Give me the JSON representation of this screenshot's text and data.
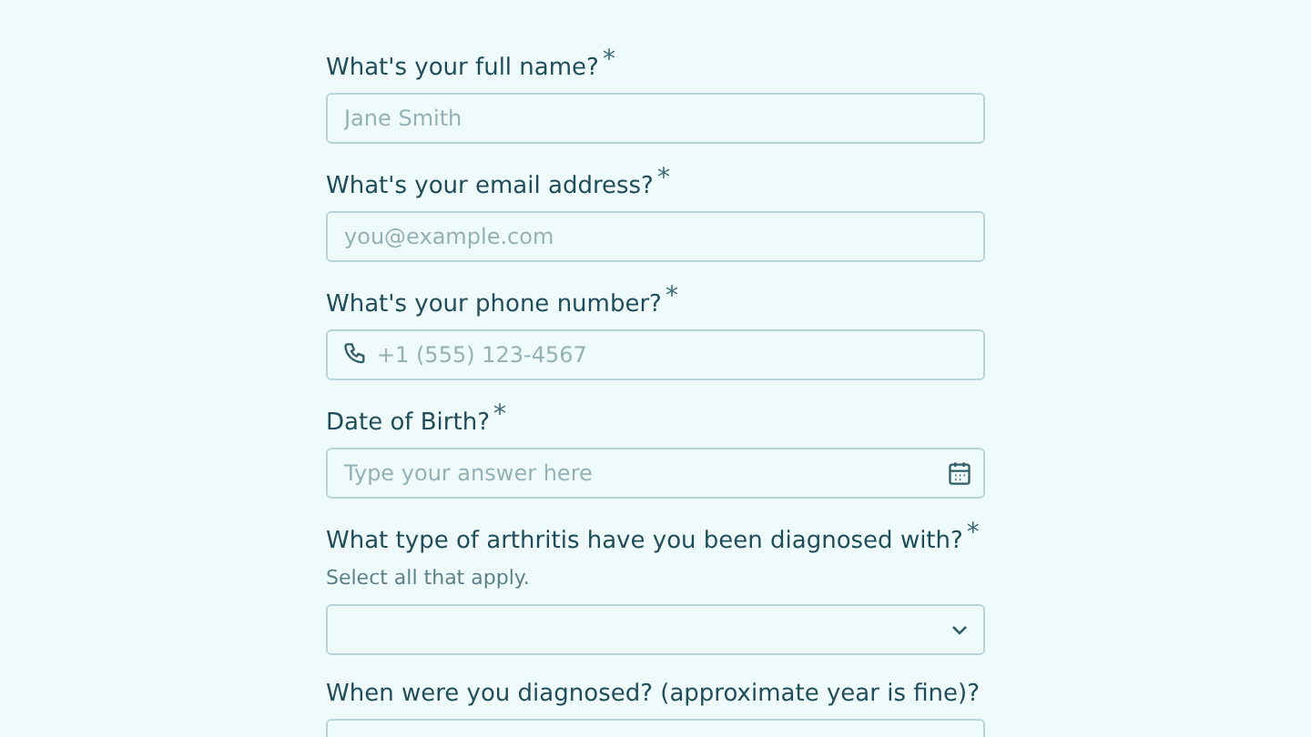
{
  "fields": [
    {
      "kind": "text",
      "label": "What's your full name?",
      "required_mark": "*",
      "placeholder": "Jane Smith"
    },
    {
      "kind": "text",
      "label": "What's your email address?",
      "required_mark": "*",
      "placeholder": "you@example.com"
    },
    {
      "kind": "phone",
      "label": "What's your phone number?",
      "required_mark": "*",
      "placeholder": "+1 (555) 123-4567"
    },
    {
      "kind": "date",
      "label": "Date of Birth?",
      "required_mark": "*",
      "placeholder": "Type your answer here"
    },
    {
      "kind": "select",
      "label": "What type of arthritis have you been diagnosed with?",
      "required_mark": "*",
      "hint": "Select all that apply."
    },
    {
      "kind": "text",
      "label": "When were you diagnosed? (approximate year is fine)?"
    }
  ]
}
